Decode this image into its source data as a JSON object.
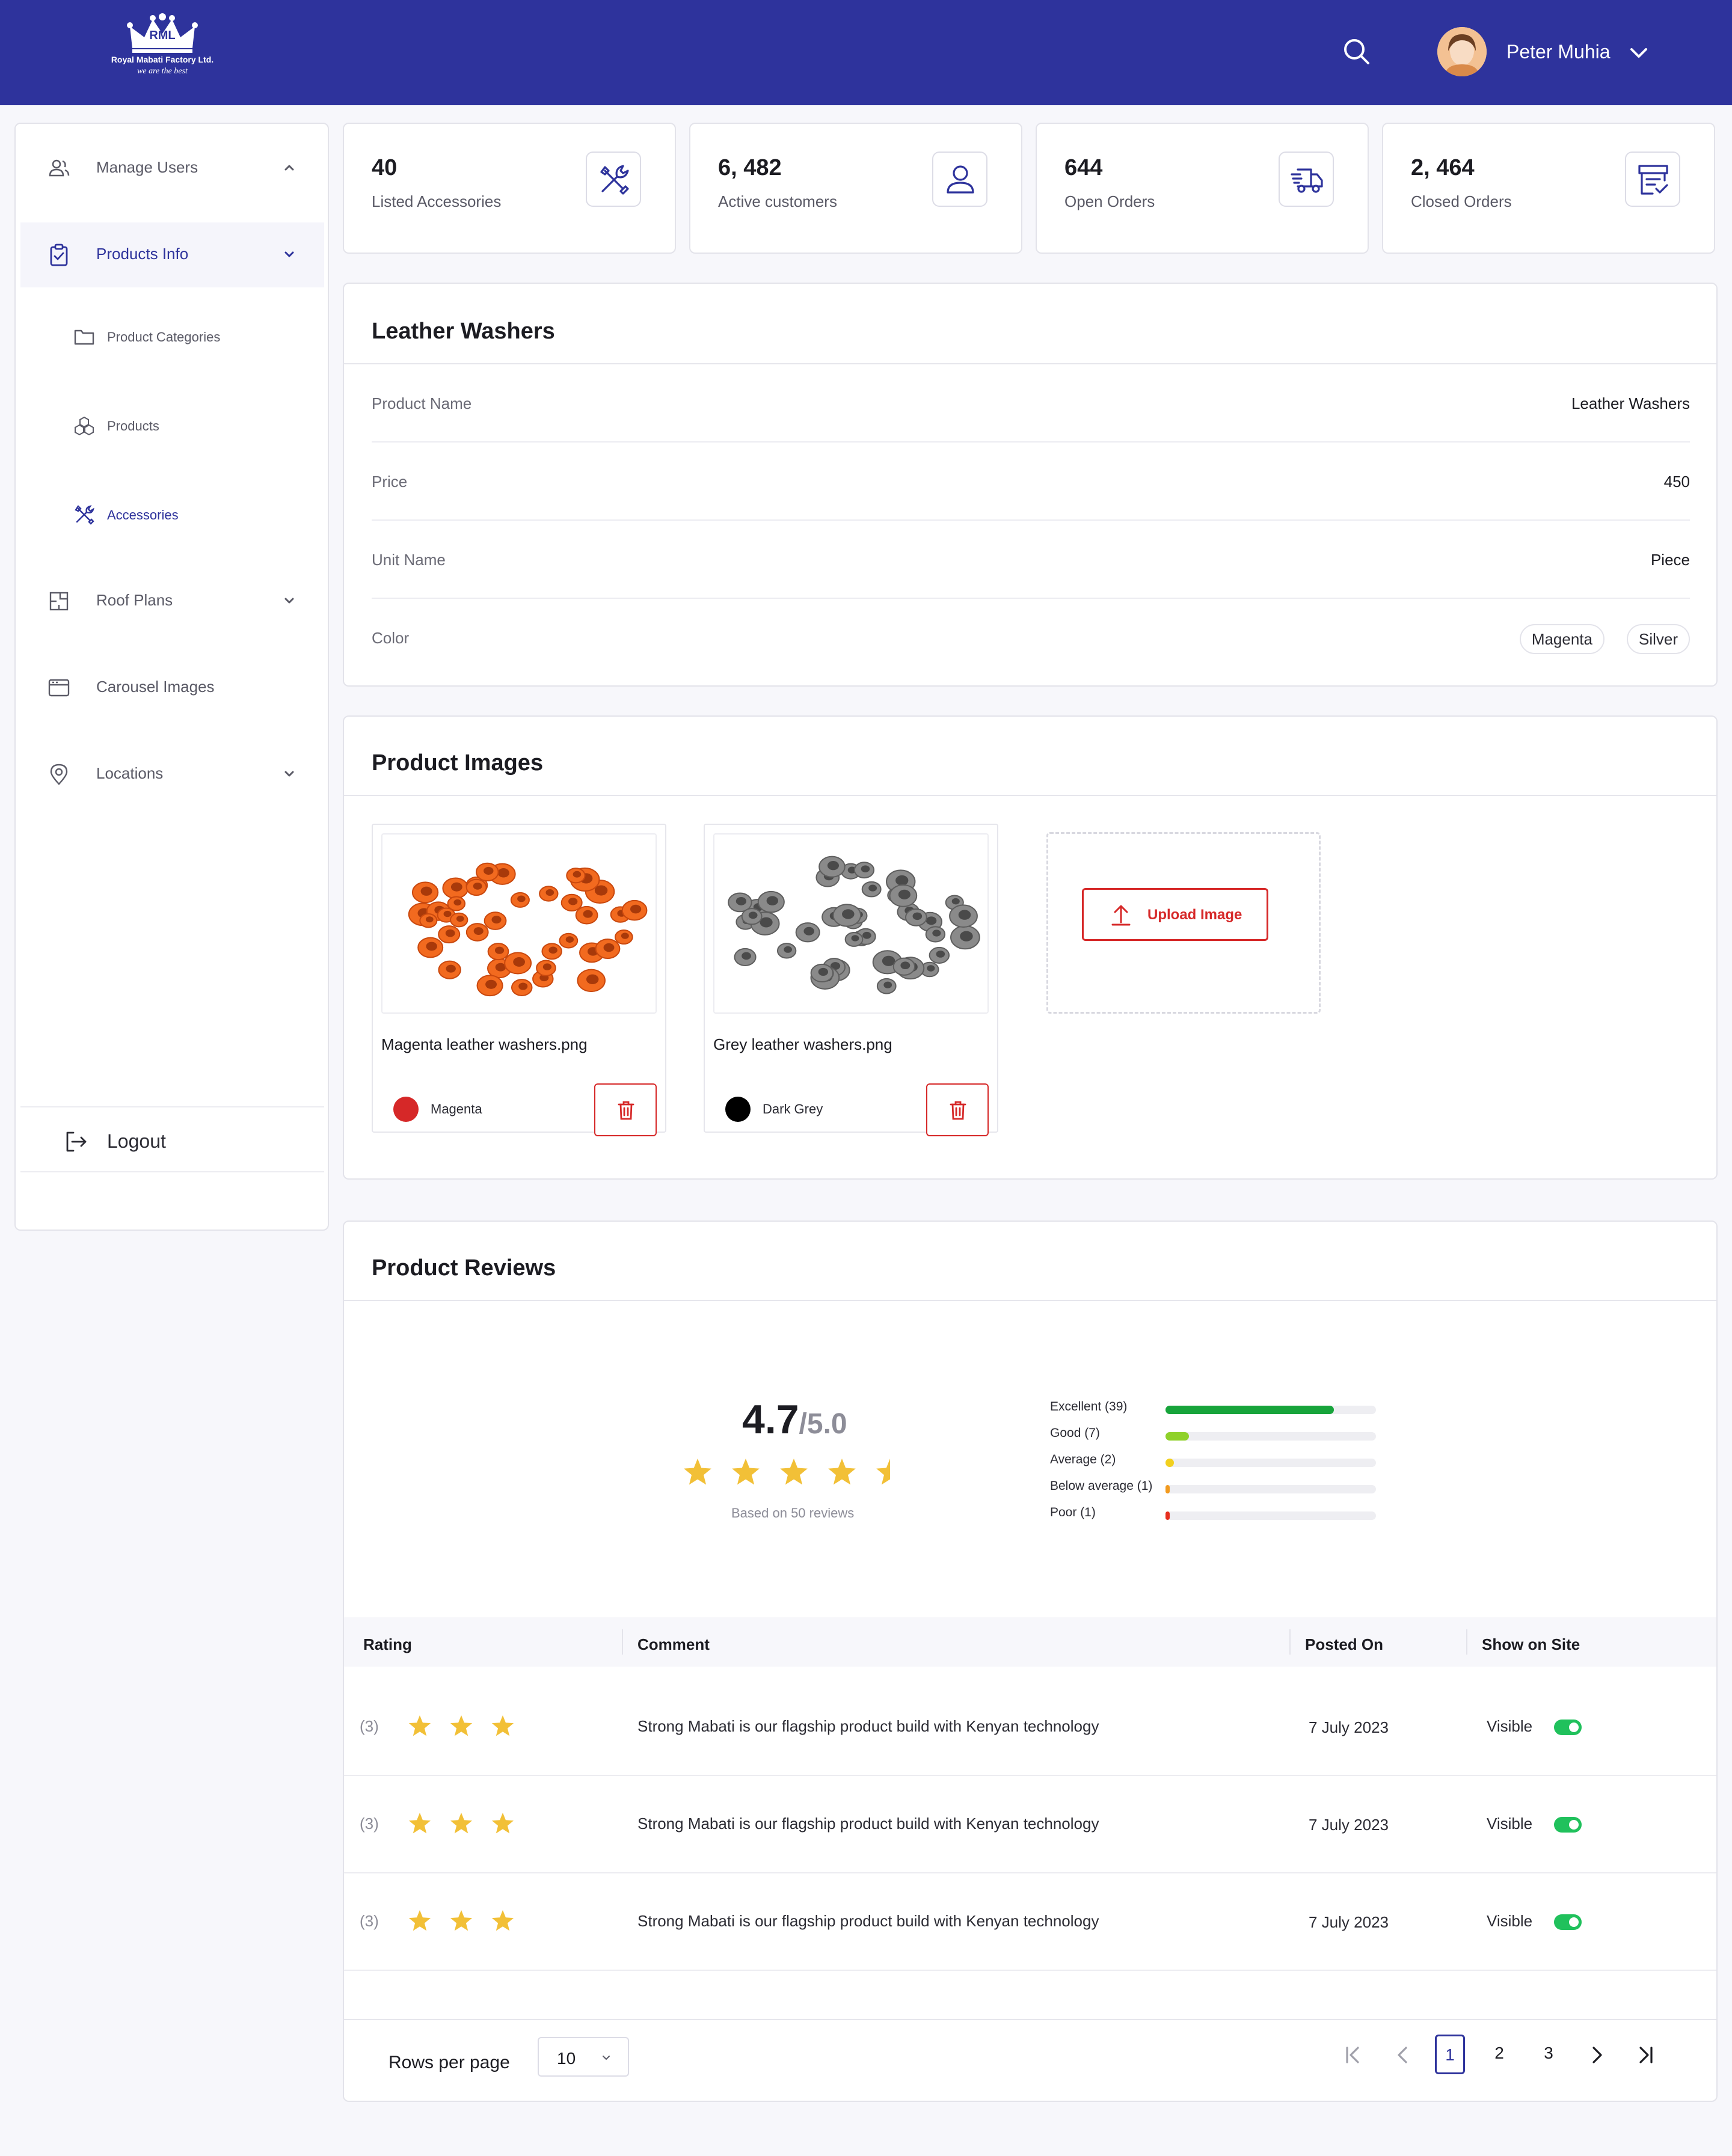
{
  "header": {
    "logo_text": "RML",
    "logo_company": "Royal Mabati Factory Ltd.",
    "logo_tagline": "we are the best",
    "user_name": "Peter Muhia"
  },
  "sidebar": {
    "manage_users": "Manage Users",
    "products_info": "Products Info",
    "product_categories": "Product Categories",
    "products": "Products",
    "accessories": "Accessories",
    "roof_plans": "Roof Plans",
    "carousel_images": "Carousel Images",
    "locations": "Locations",
    "logout": "Logout"
  },
  "stats": [
    {
      "value": "40",
      "label": "Listed Accessories",
      "icon": "tools-icon"
    },
    {
      "value": "6, 482",
      "label": "Active customers",
      "icon": "user-icon"
    },
    {
      "value": "644",
      "label": "Open Orders",
      "icon": "truck-icon"
    },
    {
      "value": "2, 464",
      "label": "Closed Orders",
      "icon": "closed-orders-icon"
    }
  ],
  "product": {
    "title": "Leather Washers",
    "fields": [
      {
        "key": "Product  Name",
        "value": "Leather Washers"
      },
      {
        "key": "Price",
        "value": "450"
      },
      {
        "key": "Unit Name",
        "value": "Piece"
      },
      {
        "key": "Color",
        "value": ""
      }
    ],
    "colors": [
      "Magenta",
      "Silver"
    ]
  },
  "images": {
    "title": "Product Images",
    "items": [
      {
        "file": "Magenta leather washers.png",
        "color_name": "Magenta",
        "color": "#d62828"
      },
      {
        "file": "Grey leather washers.png",
        "color_name": "Dark Grey",
        "color": "#000000"
      }
    ],
    "upload_label": "Upload Image"
  },
  "reviews": {
    "title": "Product Reviews",
    "score": "4.7",
    "out_of": "/5.0",
    "average_rating": 4.7,
    "based_on": "Based on 50 reviews",
    "breakdown": [
      {
        "label": "Excellent (39)",
        "fraction": 0.8,
        "color": "#17a43b"
      },
      {
        "label": "Good (7)",
        "fraction": 0.11,
        "color": "#8fd12a"
      },
      {
        "label": "Average (2)",
        "fraction": 0.04,
        "color": "#f2d01e"
      },
      {
        "label": "Below average (1)",
        "fraction": 0.02,
        "color": "#f29a1e"
      },
      {
        "label": "Poor (1)",
        "fraction": 0.02,
        "color": "#e62e1e"
      }
    ],
    "columns": [
      "Rating",
      "Comment",
      "Posted On",
      "Show on Site"
    ],
    "rows": [
      {
        "count": "(3)",
        "stars": 3,
        "comment": "Strong Mabati is our flagship product build with Kenyan technology",
        "date": "7 July 2023",
        "visibility": "Visible"
      },
      {
        "count": "(3)",
        "stars": 3,
        "comment": "Strong Mabati is our flagship product build with Kenyan technology",
        "date": "7 July 2023",
        "visibility": "Visible"
      },
      {
        "count": "(3)",
        "stars": 3,
        "comment": "Strong Mabati is our flagship product build with Kenyan technology",
        "date": "7 July 2023",
        "visibility": "Visible"
      }
    ]
  },
  "pagination": {
    "rows_label": "Rows per page",
    "rows_value": "10",
    "pages": [
      "1",
      "2",
      "3"
    ],
    "current": "1"
  },
  "colors": {
    "brand": "#2e339c",
    "danger": "#d62828",
    "star": "#f2c037",
    "toggle_on": "#20c15c"
  }
}
